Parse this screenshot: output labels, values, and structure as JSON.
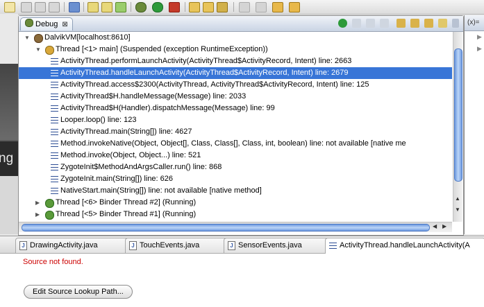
{
  "debug_view": {
    "tab_label": "Debug",
    "close_glyph": "⊠",
    "tree": [
      {
        "level": 0,
        "kind": "vm",
        "label": "DalvikVM[localhost:8610]",
        "expanded": true
      },
      {
        "level": 1,
        "kind": "thread-suspended",
        "label": "Thread [<1> main] (Suspended (exception RuntimeException))",
        "expanded": true
      },
      {
        "level": 2,
        "kind": "frame",
        "label": "ActivityThread.performLaunchActivity(ActivityThread$ActivityRecord, Intent) line: 2663"
      },
      {
        "level": 2,
        "kind": "frame",
        "label": "ActivityThread.handleLaunchActivity(ActivityThread$ActivityRecord, Intent) line: 2679",
        "selected": true
      },
      {
        "level": 2,
        "kind": "frame",
        "label": "ActivityThread.access$2300(ActivityThread, ActivityThread$ActivityRecord, Intent) line: 125"
      },
      {
        "level": 2,
        "kind": "frame",
        "label": "ActivityThread$H.handleMessage(Message) line: 2033"
      },
      {
        "level": 2,
        "kind": "frame",
        "label": "ActivityThread$H(Handler).dispatchMessage(Message) line: 99"
      },
      {
        "level": 2,
        "kind": "frame",
        "label": "Looper.loop() line: 123"
      },
      {
        "level": 2,
        "kind": "frame",
        "label": "ActivityThread.main(String[]) line: 4627"
      },
      {
        "level": 2,
        "kind": "frame",
        "label": "Method.invokeNative(Object, Object[], Class, Class[], Class, int, boolean) line: not available [native me"
      },
      {
        "level": 2,
        "kind": "frame",
        "label": "Method.invoke(Object, Object...) line: 521"
      },
      {
        "level": 2,
        "kind": "frame",
        "label": "ZygoteInit$MethodAndArgsCaller.run() line: 868"
      },
      {
        "level": 2,
        "kind": "frame",
        "label": "ZygoteInit.main(String[]) line: 626"
      },
      {
        "level": 2,
        "kind": "frame",
        "label": "NativeStart.main(String[]) line: not available [native method]"
      },
      {
        "level": 1,
        "kind": "thread-running",
        "label": "Thread [<6> Binder Thread #2] (Running)"
      },
      {
        "level": 1,
        "kind": "thread-running",
        "label": "Thread [<5> Binder Thread #1] (Running)"
      }
    ]
  },
  "left_strip_text": "ng",
  "right_view": {
    "header": "(x)="
  },
  "editor": {
    "tabs": [
      {
        "label": "DrawingActivity.java",
        "icon": "java-file-icon"
      },
      {
        "label": "TouchEvents.java",
        "icon": "java-file-icon"
      },
      {
        "label": "SensorEvents.java",
        "icon": "java-file-icon"
      },
      {
        "label": "ActivityThread.handleLaunchActivity(A",
        "icon": "stack-frame-icon",
        "active": true
      }
    ],
    "message": "Source not found.",
    "button_label": "Edit Source Lookup Path..."
  },
  "colors": {
    "selection": "#3875d7",
    "error_text": "#cc0000",
    "frame_icon": "#2c4d94"
  }
}
